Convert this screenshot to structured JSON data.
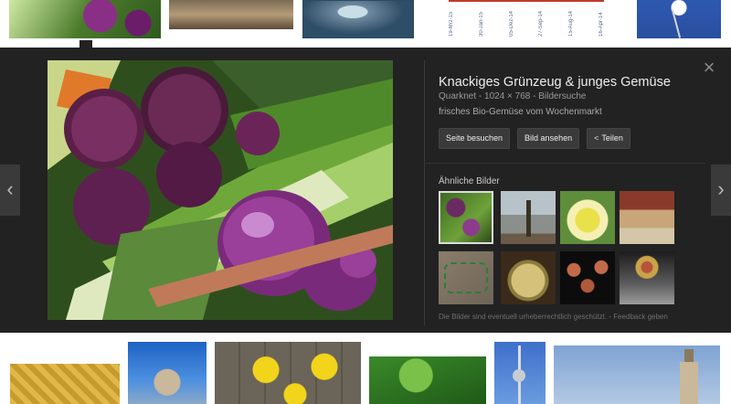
{
  "top_strip": {
    "chart_dates": [
      "19-Mrz-15",
      "30-Jan-15",
      "05-Dez-14",
      "27-Sep-14",
      "15-Aug-14",
      "16-Apr-14"
    ]
  },
  "preview": {
    "title": "Knackiges Grünzeug & junges Gemüse",
    "meta": "Quarknet - 1024 × 768 - Bildersuche",
    "description": "frisches Bio-Gemüse vom Wochenmarkt",
    "buttons": {
      "visit": "Seite besuchen",
      "view": "Bild ansehen",
      "share": "Teilen"
    },
    "similar_label": "Ähnliche Bilder",
    "footer_note": "Die Bilder sind eventuell urheberrechtlich geschützt.  -  Feedback geben",
    "close_glyph": "×",
    "prev_glyph": "‹",
    "next_glyph": "›",
    "share_glyph": "<"
  },
  "icons": [
    "close-icon",
    "chevron-left-icon",
    "chevron-right-icon",
    "share-icon"
  ],
  "colors": {
    "overlay_bg": "#222222",
    "button_bg": "#3a3a3a",
    "title_text": "#eeeeee"
  }
}
